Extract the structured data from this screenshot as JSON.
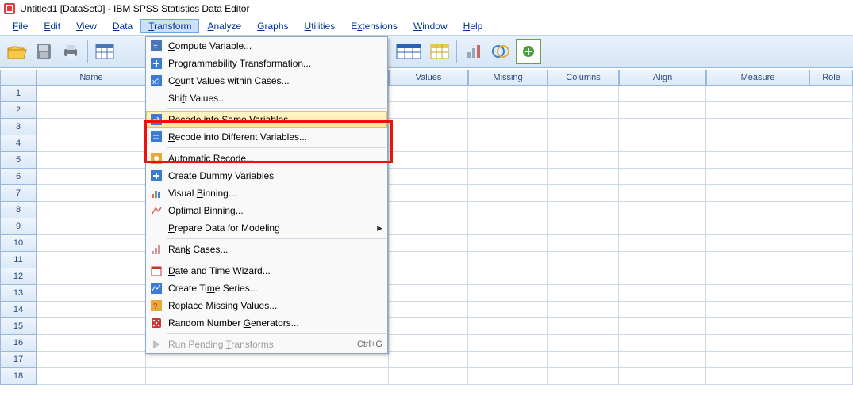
{
  "title": "Untitled1 [DataSet0] - IBM SPSS Statistics Data Editor",
  "menubar": {
    "file": "File",
    "edit": "Edit",
    "view": "View",
    "data": "Data",
    "transform": "Transform",
    "analyze": "Analyze",
    "graphs": "Graphs",
    "utilities": "Utilities",
    "extensions": "Extensions",
    "window": "Window",
    "help": "Help"
  },
  "dropdown": {
    "compute": "Compute Variable...",
    "prog": "Programmability Transformation...",
    "count": "Count Values within Cases...",
    "shift": "Shift Values...",
    "recode_same": "Recode into Same Variables...",
    "recode_diff": "Recode into Different Variables...",
    "auto": "Automatic Recode...",
    "dummy": "Create Dummy Variables",
    "visual": "Visual Binning...",
    "optimal": "Optimal Binning...",
    "prepare": "Prepare Data for Modeling",
    "rank": "Rank Cases...",
    "datetime": "Date and Time Wizard...",
    "timeseries": "Create Time Series...",
    "replace": "Replace Missing Values...",
    "random": "Random Number Generators...",
    "pending": "Run Pending Transforms",
    "pending_shortcut": "Ctrl+G"
  },
  "columns": {
    "name": "Name",
    "values": "Values",
    "missing": "Missing",
    "columns": "Columns",
    "align": "Align",
    "measure": "Measure",
    "role": "Role"
  },
  "rows": [
    "1",
    "2",
    "3",
    "4",
    "5",
    "6",
    "7",
    "8",
    "9",
    "10",
    "11",
    "12",
    "13",
    "14",
    "15",
    "16",
    "17",
    "18"
  ]
}
